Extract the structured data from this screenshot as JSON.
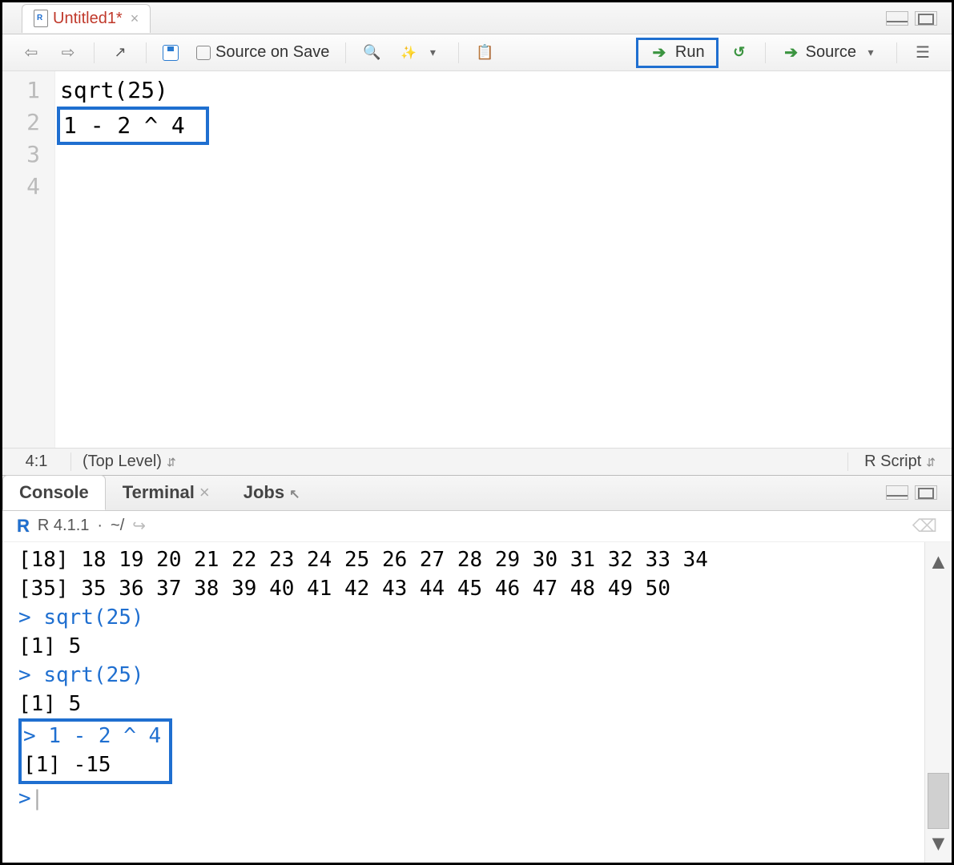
{
  "tab": {
    "name": "Untitled1*",
    "close": "×"
  },
  "toolbar": {
    "source_on_save": "Source on Save",
    "run": "Run",
    "source": "Source"
  },
  "editor": {
    "gutter": [
      "1",
      "2",
      "3",
      "4"
    ],
    "line1": "sqrt(25)",
    "line2": "",
    "line3": "1 - 2 ^ 4",
    "line4": ""
  },
  "status": {
    "position": "4:1",
    "scope": "(Top Level)",
    "language": "R Script"
  },
  "console_tabs": {
    "console": "Console",
    "terminal": "Terminal",
    "jobs": "Jobs"
  },
  "console_header": {
    "version": "R 4.1.1",
    "sep": "·",
    "path": "~/"
  },
  "console": {
    "out_row1": "[18] 18 19 20 21 22 23 24 25 26 27 28 29 30 31 32 33 34",
    "out_row2": "[35] 35 36 37 38 39 40 41 42 43 44 45 46 47 48 49 50",
    "p1": ">",
    "c1": "sqrt(25)",
    "r1": "[1] 5",
    "p2": ">",
    "c2": "sqrt(25)",
    "r2": "[1] 5",
    "p3": ">",
    "c3": "1 - 2 ^ 4",
    "r3": "[1] -15",
    "p4": ">"
  }
}
